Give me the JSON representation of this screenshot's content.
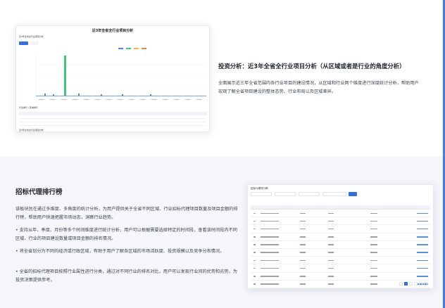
{
  "section1": {
    "heading": "投资分析：近3年全省全行业项目分析（从区域或者是行业的角度分析）",
    "paragraph": "全面展示近三年全省范围内各行业项目的建设情况，从区域和行业两个维度进行深度统计分析，帮助用户宏观了解全省项目建设的整体态势、行业布局以及区域差异。",
    "screenshot": {
      "title": "近3年全省全行业项目分析",
      "sub1": "近3年全省全行业项目分析",
      "sub2": "行业排行 / 区域排行",
      "sub3": "近3年全省全行业项目分析",
      "legend_colors": [
        "#4a86f7",
        "#3ec97a",
        "#f6b73c",
        "#f07c4f"
      ],
      "accent": "#2f6fed"
    }
  },
  "section2": {
    "heading": "招标代理排行榜",
    "paragraphs": [
      "该板块旨在通过多维度、多角度的统计分析，为用户提供关于全省不同区域、行业招标代理项目数量及项目金额的排行榜，帮助用户快速把握市场动态，洞察行业趋势。",
      "支持从年、季度、月份等多个时间维度进行统计分析，用户可以根据需要选择特定的时间段，查看该时间段内不同区域、行业的项目建设数量或项目金额的排名情况。",
      "将全省划分为不同的经济或行政区域，有助于用户了解各区域的市场活跃度、投资规模以及竞争分布情况。",
      "全省的招标代理项目按照行业属性进行分类，通过对不同行业的排名对比，用户可以发现行业间的优势和劣势，为投资决策提供参考。"
    ],
    "screenshot": {
      "title": "招标代理排行榜",
      "rows": 10
    }
  }
}
